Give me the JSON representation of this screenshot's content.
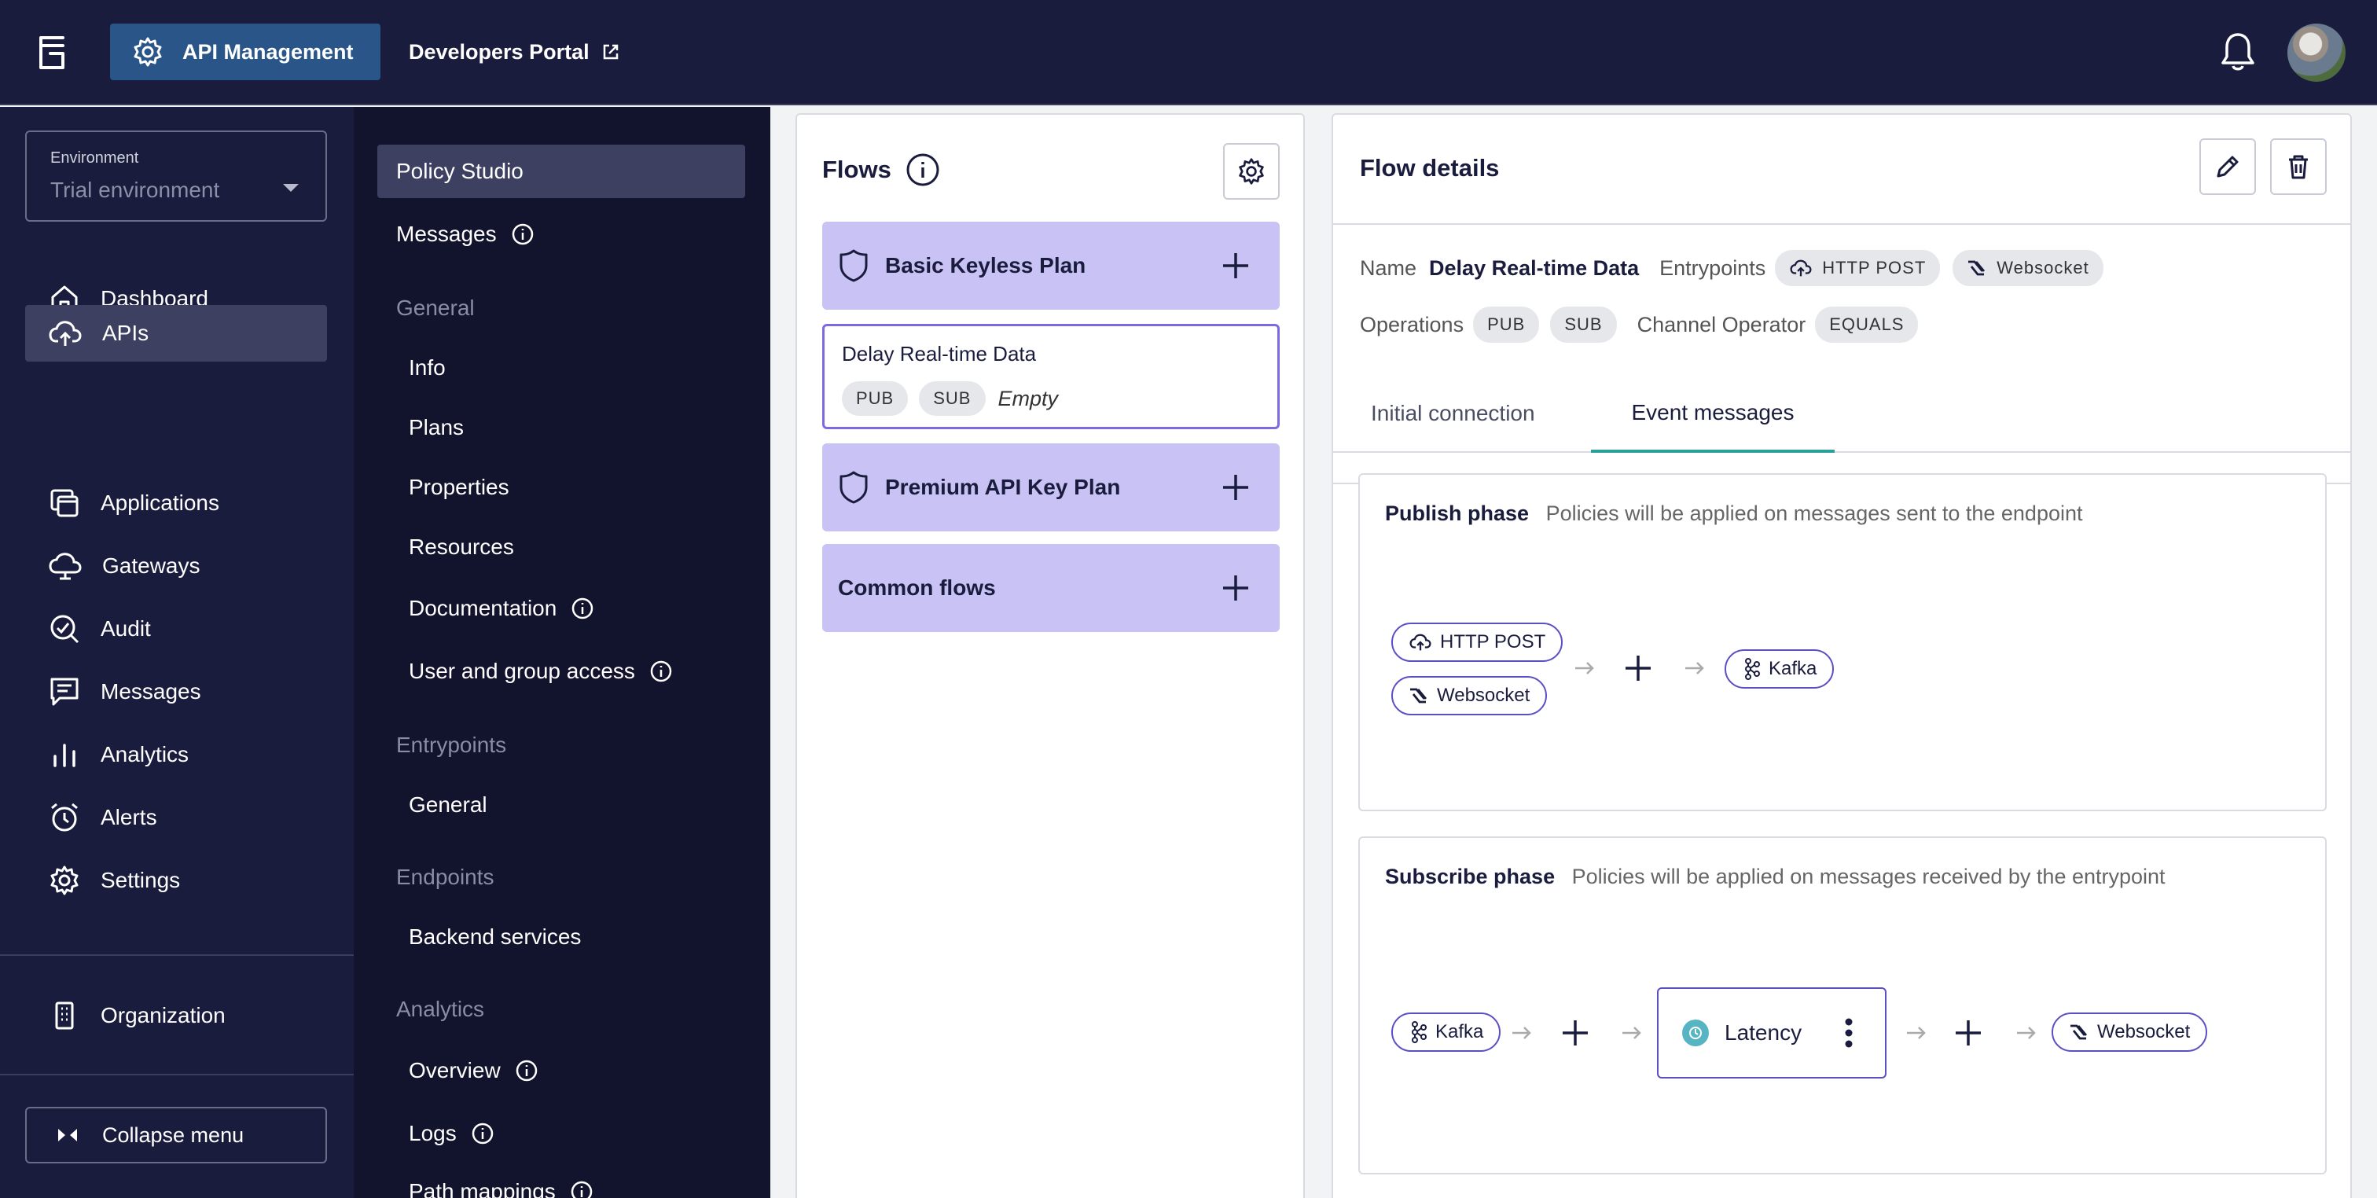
{
  "topbar": {
    "app_label": "API Management",
    "portal_label": "Developers Portal"
  },
  "sidebar": {
    "environment_label": "Environment",
    "environment_value": "Trial environment",
    "items": [
      {
        "label": "Dashboard",
        "icon": "home-icon"
      },
      {
        "label": "APIs",
        "icon": "cloud-upload-icon"
      },
      {
        "label": "Applications",
        "icon": "applications-icon"
      },
      {
        "label": "Gateways",
        "icon": "gateway-icon"
      },
      {
        "label": "Audit",
        "icon": "audit-icon"
      },
      {
        "label": "Messages",
        "icon": "messages-icon"
      },
      {
        "label": "Analytics",
        "icon": "analytics-icon"
      },
      {
        "label": "Alerts",
        "icon": "alarm-icon"
      },
      {
        "label": "Settings",
        "icon": "gear-icon"
      }
    ],
    "organization_label": "Organization",
    "collapse_label": "Collapse menu"
  },
  "submenu": {
    "policy_studio": "Policy Studio",
    "messages": "Messages",
    "general_head": "General",
    "info": "Info",
    "plans": "Plans",
    "properties": "Properties",
    "resources": "Resources",
    "documentation": "Documentation",
    "user_group_access": "User and group access",
    "entrypoints_head": "Entrypoints",
    "entrypoints_general": "General",
    "endpoints_head": "Endpoints",
    "backend_services": "Backend services",
    "analytics_head": "Analytics",
    "overview": "Overview",
    "logs": "Logs",
    "path_mappings": "Path mappings"
  },
  "flows": {
    "title": "Flows",
    "plans": [
      {
        "name": "Basic Keyless Plan"
      },
      {
        "name": "Premium API Key Plan"
      },
      {
        "name": "Common flows"
      }
    ],
    "selected_flow": {
      "name": "Delay Real-time Data",
      "ops": [
        "PUB",
        "SUB"
      ],
      "condition": "Empty"
    }
  },
  "details": {
    "title": "Flow details",
    "name_label": "Name",
    "name_value": "Delay Real-time Data",
    "entrypoints_label": "Entrypoints",
    "entrypoints": [
      "HTTP POST",
      "Websocket"
    ],
    "operations_label": "Operations",
    "operations": [
      "PUB",
      "SUB"
    ],
    "channel_operator_label": "Channel Operator",
    "channel_operator": "EQUALS",
    "tabs": [
      "Initial connection",
      "Event messages"
    ],
    "active_tab": "Event messages",
    "publish": {
      "title": "Publish phase",
      "description": "Policies will be applied on messages sent to the endpoint",
      "inputs": [
        "HTTP POST",
        "Websocket"
      ],
      "output": "Kafka"
    },
    "subscribe": {
      "title": "Subscribe phase",
      "description": "Policies will be applied on messages received by the entrypoint",
      "input": "Kafka",
      "policy": "Latency",
      "output": "Websocket"
    }
  },
  "colors": {
    "topbar_bg": "#1a1c3d",
    "active_app_bg": "#2a5589",
    "plan_bg": "#c8c3f4",
    "accent_border": "#7b6ae0",
    "tab_underline": "#2aa198",
    "policy_dot": "#57b4c2"
  }
}
